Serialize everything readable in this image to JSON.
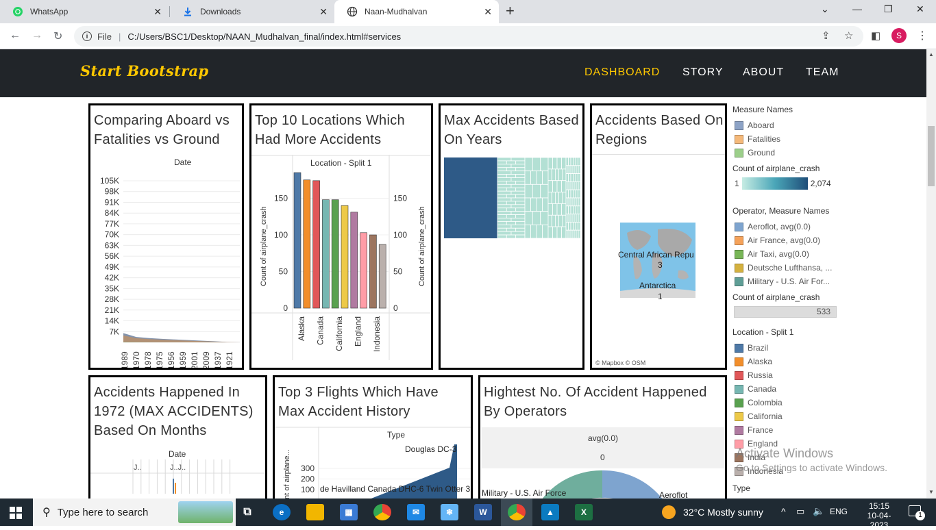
{
  "browser": {
    "tabs": [
      {
        "title": "WhatsApp"
      },
      {
        "title": "Downloads"
      },
      {
        "title": "Naan-Mudhalvan"
      }
    ],
    "address": {
      "scheme_label": "File",
      "url": "C:/Users/BSC1/Desktop/NAAN_Mudhalvan_final/index.html#services"
    },
    "profile_initial": "S"
  },
  "site": {
    "brand": "Start Bootstrap",
    "nav": [
      "DASHBOARD",
      "STORY",
      "ABOUT",
      "TEAM"
    ],
    "active_nav": "DASHBOARD"
  },
  "panels": {
    "p1": {
      "title_line1": "Comparing Aboard vs",
      "title_line2": "Fatalities vs Ground",
      "header": "Date"
    },
    "p2": {
      "title_line1": "Top 10 Locations Which",
      "title_line2": "Had More Accidents",
      "header": "Location - Split 1",
      "axis_label": "Count of airplane_crash"
    },
    "p3": {
      "title_line1": "Max Accidents Based",
      "title_line2": "On Years"
    },
    "p4": {
      "title_line1": "Accidents Based On",
      "title_line2": "Regions",
      "map_label1": "Central African Repu",
      "map_value1": "3",
      "map_label2": "Antarctica",
      "map_value2": "1",
      "attribution": "© Mapbox  © OSM"
    },
    "p5": {
      "title_line1": "Accidents Happened In",
      "title_line2": "1972 (MAX ACCIDENTS)",
      "title_line3": "Based On Months",
      "header": "Date",
      "tick_label": "J..",
      "tick_label2": "J..J.."
    },
    "p6": {
      "title_line1": "Top 3 Flights Which Have",
      "title_line2": "Max Accident History",
      "header": "Type",
      "axis_label": "nt of airplane...",
      "label_a": "Douglas DC-3",
      "label_b": "de Havilland Canada DHC-6 Twin Otter 3"
    },
    "p7": {
      "title_line1": "Hightest No. Of Accident Happened",
      "title_line2": "By Operators",
      "header": "avg(0.0)",
      "header_value": "0",
      "label_a": "Military - U.S. Air Force",
      "label_b": "Aeroflot"
    }
  },
  "chart_data": [
    {
      "type": "area",
      "title": "Comparing Aboard vs Fatalities vs Ground",
      "xlabel": "Date",
      "ytick_labels": [
        "105K",
        "98K",
        "91K",
        "84K",
        "77K",
        "70K",
        "63K",
        "56K",
        "49K",
        "42K",
        "35K",
        "28K",
        "21K",
        "14K",
        "7K"
      ],
      "xtick_labels": [
        "1989",
        "1970",
        "1978",
        "1975",
        "1956",
        "1959",
        "2001",
        "2009",
        "1937",
        "1921"
      ],
      "ylim": [
        0,
        105000
      ],
      "series": [
        {
          "name": "Aboard",
          "values": [
            6000,
            3500,
            2800,
            2300,
            1900,
            1500,
            1100,
            700,
            300,
            100
          ]
        },
        {
          "name": "Fatalities",
          "values": [
            4500,
            2700,
            2100,
            1700,
            1400,
            1100,
            800,
            500,
            200,
            80
          ]
        },
        {
          "name": "Ground",
          "values": [
            300,
            150,
            100,
            80,
            60,
            50,
            40,
            30,
            20,
            10
          ]
        }
      ]
    },
    {
      "type": "bar",
      "title": "Top 10 Locations Which Had More Accidents",
      "xlabel": "Location - Split 1",
      "ylabel": "Count of airplane_crash",
      "categories": [
        "Brazil",
        "Alaska",
        "Russia",
        "Canada",
        "Colombia",
        "California",
        "France",
        "England",
        "India",
        "Indonesia"
      ],
      "xtick_labels": [
        "Alaska",
        "Canada",
        "California",
        "England",
        "Indonesia"
      ],
      "values": [
        185,
        175,
        174,
        148,
        148,
        140,
        131,
        103,
        100,
        87
      ],
      "ylim": [
        0,
        200
      ],
      "yticks": [
        0,
        50,
        100,
        150
      ]
    },
    {
      "type": "heatmap",
      "title": "Max Accidents Based On Years",
      "note": "treemap"
    },
    {
      "type": "bar",
      "title": "Top 3 Flights Which Have Max Accident History",
      "xlabel": "Type",
      "categories": [
        "de Havilland Canada DHC-6 Twin Otter 3",
        "Douglas DC-3"
      ],
      "yticks": [
        100,
        200,
        300
      ]
    },
    {
      "type": "pie",
      "title": "Hightest No. Of Accident Happened By Operators",
      "categories": [
        "Military - U.S. Air Force",
        "Aeroflot"
      ]
    }
  ],
  "legend": {
    "measure_title": "Measure Names",
    "measures": [
      {
        "label": "Aboard",
        "color": "#8da3c6"
      },
      {
        "label": "Fatalities",
        "color": "#f5b97a"
      },
      {
        "label": "Ground",
        "color": "#9ccf8a"
      }
    ],
    "count_title": "Count of airplane_crash",
    "count_min": "1",
    "count_max": "2,074",
    "operator_title": "Operator, Measure Names",
    "operators": [
      {
        "label": "Aeroflot, avg(0.0)",
        "color": "#7ea4cf"
      },
      {
        "label": "Air France, avg(0.0)",
        "color": "#f5a25a"
      },
      {
        "label": "Air Taxi, avg(0.0)",
        "color": "#78b657"
      },
      {
        "label": "Deutsche Lufthansa, ...",
        "color": "#d4b13f"
      },
      {
        "label": "Military - U.S. Air For...",
        "color": "#5f9e96"
      }
    ],
    "count2_title": "Count of airplane_crash",
    "count2_value": "533",
    "location_title": "Location - Split 1",
    "locations": [
      {
        "label": "Brazil",
        "color": "#4e79a7"
      },
      {
        "label": "Alaska",
        "color": "#f28e2b"
      },
      {
        "label": "Russia",
        "color": "#e15759"
      },
      {
        "label": "Canada",
        "color": "#76b7b2"
      },
      {
        "label": "Colombia",
        "color": "#59a14f"
      },
      {
        "label": "California",
        "color": "#edc948"
      },
      {
        "label": "France",
        "color": "#b07aa1"
      },
      {
        "label": "England",
        "color": "#ff9da7"
      },
      {
        "label": "India",
        "color": "#9c755f"
      },
      {
        "label": "Indonesia",
        "color": "#bab0ac"
      }
    ],
    "type_title": "Type"
  },
  "watermark": {
    "line1": "Activate Windows",
    "line2": "Go to Settings to activate Windows."
  },
  "taskbar": {
    "search_placeholder": "Type here to search",
    "weather": "32°C  Mostly sunny",
    "language": "ENG",
    "time": "15:15",
    "date": "10-04-2023",
    "notification_count": "1"
  }
}
